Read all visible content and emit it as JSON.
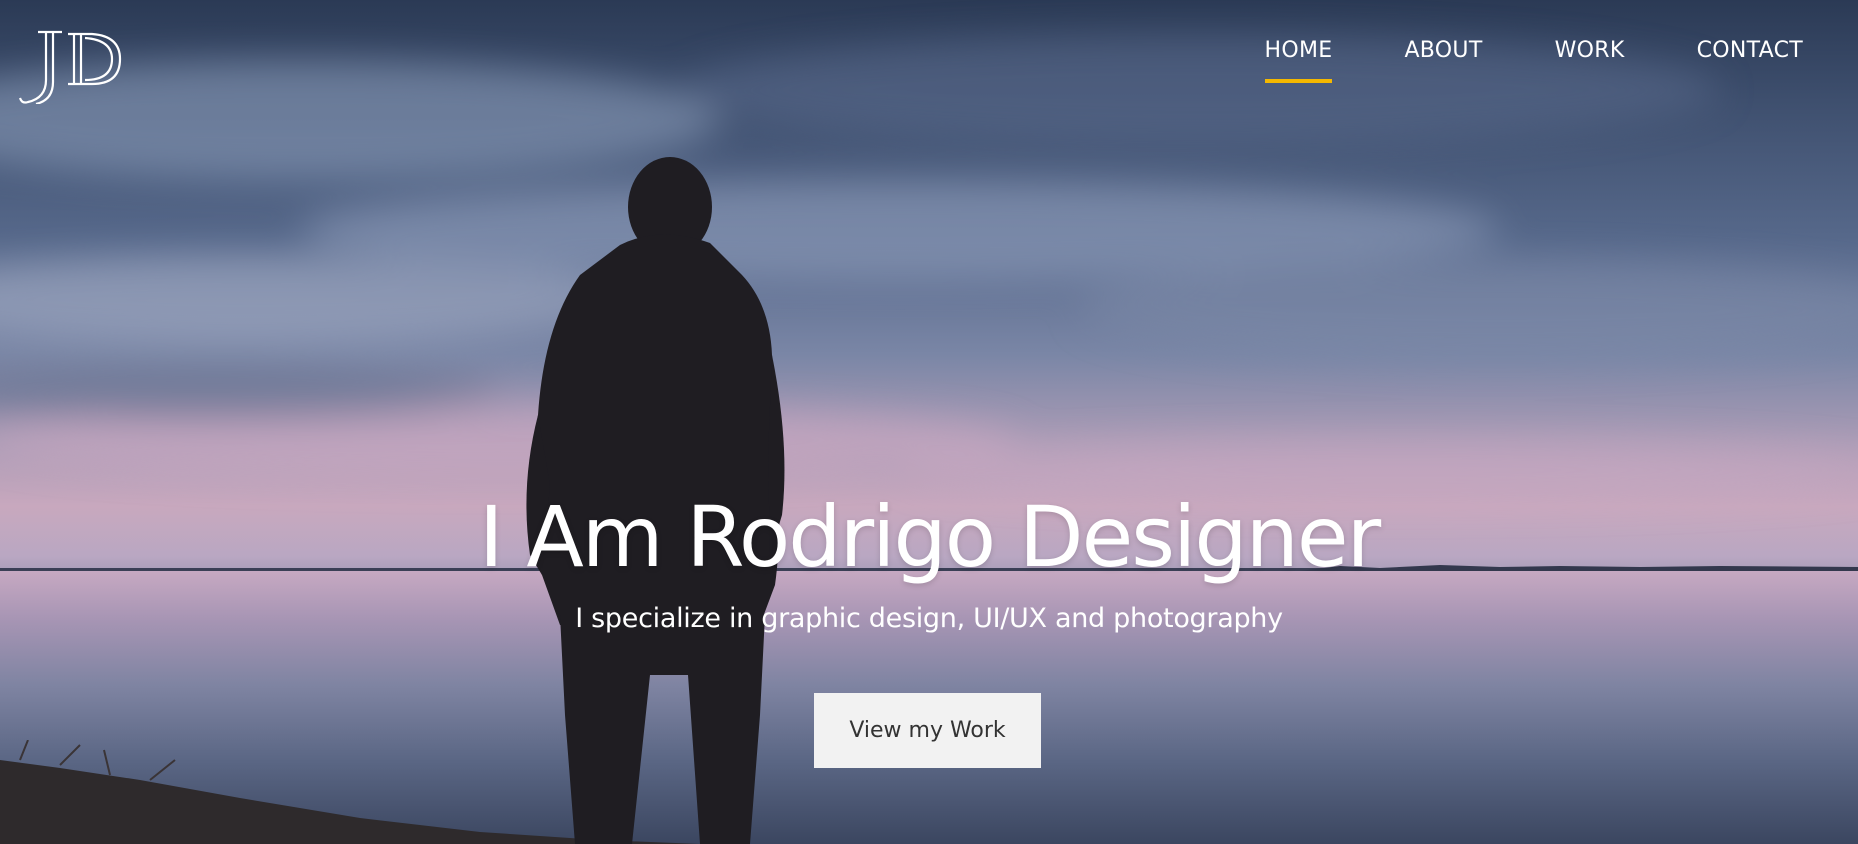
{
  "logo": {
    "text": "JD"
  },
  "nav": {
    "items": [
      {
        "label": "HOME",
        "active": true
      },
      {
        "label": "ABOUT",
        "active": false
      },
      {
        "label": "WORK",
        "active": false
      },
      {
        "label": "CONTACT",
        "active": false
      }
    ],
    "active_underline_color": "#f5b800"
  },
  "hero": {
    "headline": "I Am Rodrigo Designer",
    "subheadline": "I specialize in graphic design, UI/UX and photography",
    "cta_label": "View my Work"
  },
  "colors": {
    "text": "#ffffff",
    "button_bg": "#f2f2f2",
    "button_text": "#333333"
  }
}
